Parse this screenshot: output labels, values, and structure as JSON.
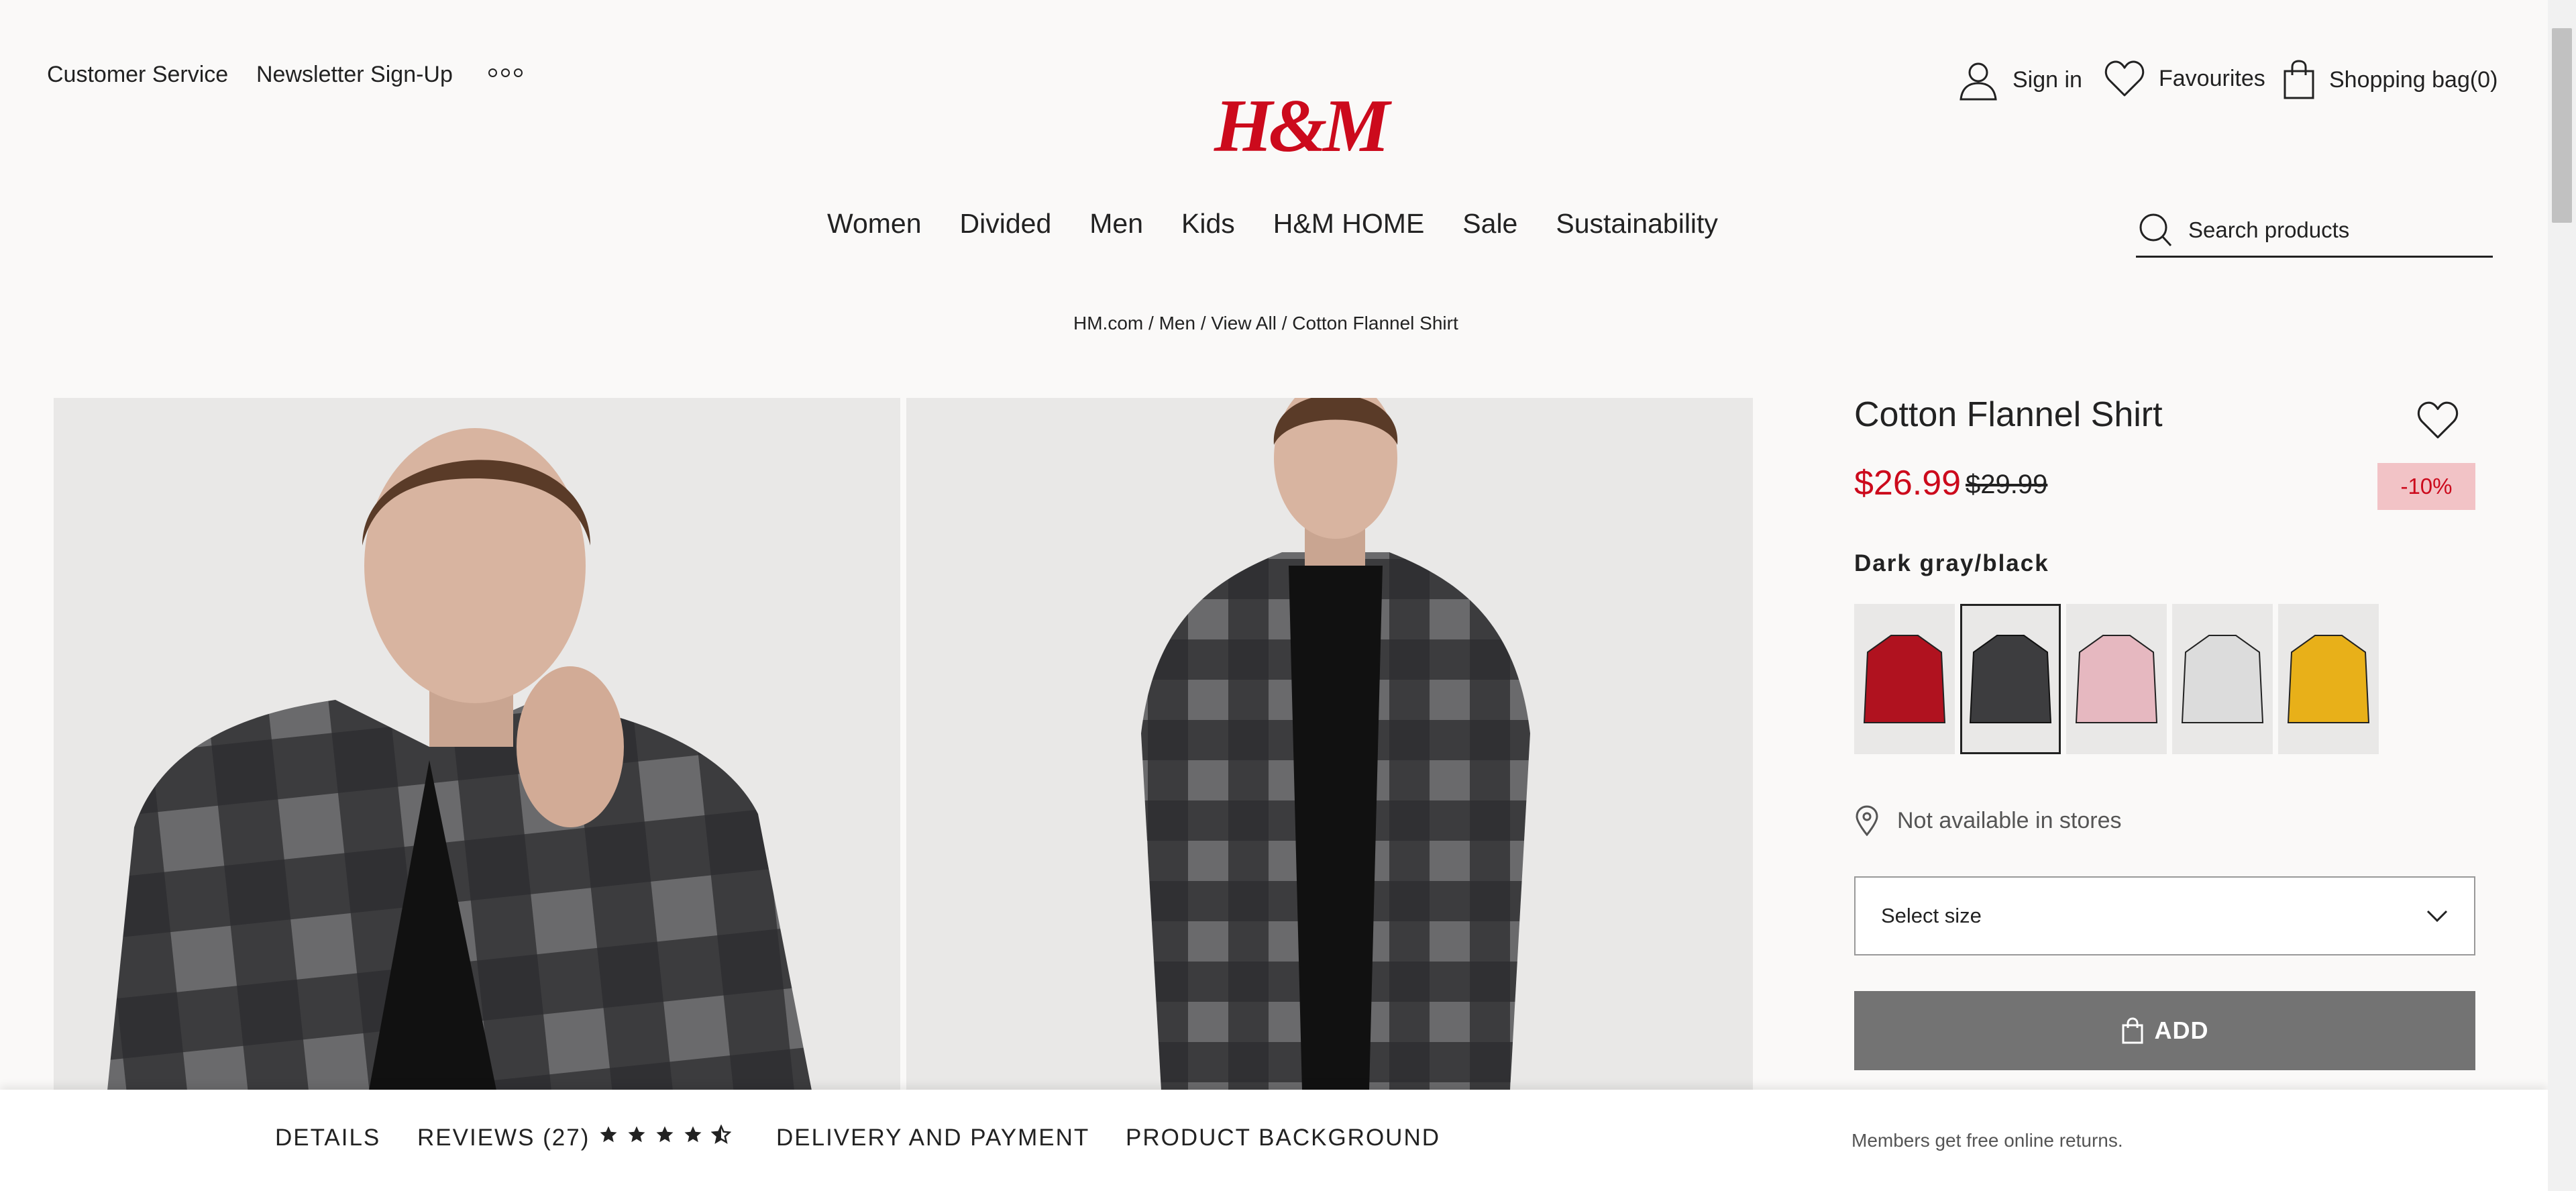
{
  "header": {
    "customer_service": "Customer Service",
    "newsletter": "Newsletter Sign-Up",
    "logo": "H&M",
    "sign_in": "Sign in",
    "favourites": "Favourites",
    "shopping_bag": "Shopping bag(0)"
  },
  "nav": {
    "items": [
      "Women",
      "Divided",
      "Men",
      "Kids",
      "H&M HOME",
      "Sale",
      "Sustainability"
    ]
  },
  "search": {
    "placeholder": "Search products"
  },
  "breadcrumb": {
    "items": [
      "HM.com",
      "Men",
      "View All",
      "Cotton Flannel Shirt"
    ],
    "separator": " / "
  },
  "product": {
    "title": "Cotton Flannel Shirt",
    "price": "$26.99",
    "original_price": "$29.99",
    "discount": "-10%",
    "color_name": "Dark gray/black",
    "swatch_colors": [
      "#b0121f",
      "#3d3d3f",
      "#e6b8c0",
      "#dcdcdc",
      "#e8b019"
    ],
    "selected_swatch": 1,
    "store_availability": "Not available in stores",
    "size_select": "Select size",
    "add_button": "ADD"
  },
  "bottom_bar": {
    "details": "DETAILS",
    "reviews": "REVIEWS (27)",
    "rating": 4.5,
    "delivery": "DELIVERY AND PAYMENT",
    "background": "PRODUCT BACKGROUND",
    "returns_note": "Members get free online returns."
  },
  "colors": {
    "brand_red": "#cc0a1c",
    "discount_bg": "#f2c3c6",
    "add_button_bg": "#737373"
  }
}
